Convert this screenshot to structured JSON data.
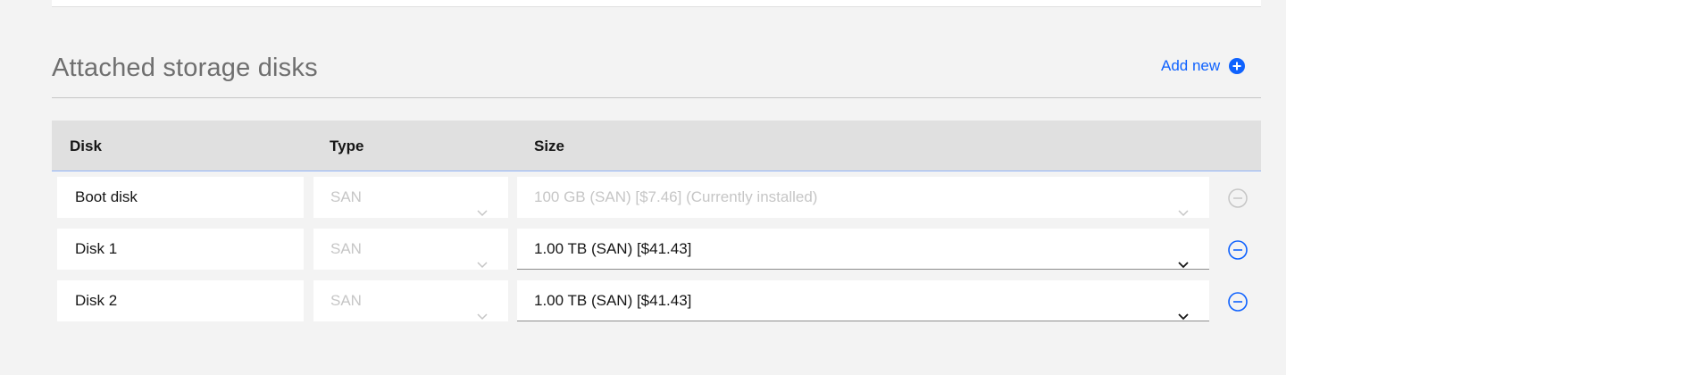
{
  "section": {
    "title": "Attached storage disks",
    "add_new_label": "Add new"
  },
  "table": {
    "headers": [
      "Disk",
      "Type",
      "Size"
    ],
    "rows": [
      {
        "name": "Boot disk",
        "type": "SAN",
        "size": "100 GB (SAN) [$7.46] (Currently installed)",
        "disabled": true
      },
      {
        "name": "Disk 1",
        "type": "SAN",
        "size": "1.00 TB (SAN) [$41.43]",
        "disabled": false
      },
      {
        "name": "Disk 2",
        "type": "SAN",
        "size": "1.00 TB (SAN) [$41.43]",
        "disabled": false
      }
    ]
  },
  "colors": {
    "accent": "#0f62fe",
    "panel_bg": "#f3f3f3",
    "header_bg": "#e0e0e0",
    "disabled_text": "#c6c6c6"
  },
  "icons": {
    "add": "add-filled-icon",
    "remove": "subtract-alt-icon",
    "chevron": "chevron-down-icon"
  }
}
